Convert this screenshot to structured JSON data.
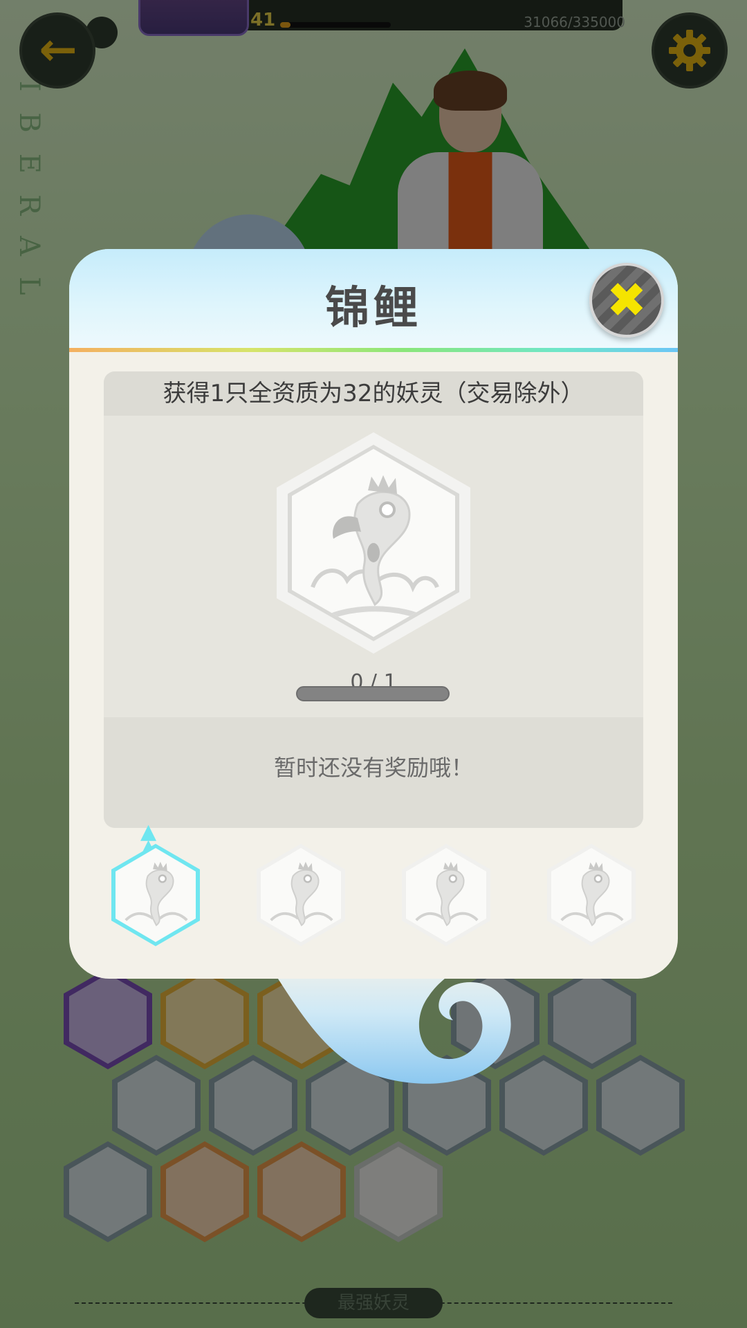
{
  "hud": {
    "level": "41",
    "exp_text": "31066/335000",
    "exp_fraction": 0.093
  },
  "background": {
    "side_text": "LIBERAL",
    "bottom_tab": "最强妖灵"
  },
  "modal": {
    "title": "锦鲤",
    "task_text": "获得1只全资质为32的妖灵（交易除外）",
    "progress_text": "0 / 1",
    "progress_fraction": 0,
    "reward_text": "暂时还没有奖励哦！",
    "tiers": [
      {
        "active": true
      },
      {
        "active": false
      },
      {
        "active": false
      },
      {
        "active": false
      }
    ]
  },
  "colors": {
    "accent_cyan": "#6fe6f0",
    "close_x": "#f5e400",
    "hud_yellow": "#e8b814"
  },
  "icons": {
    "back": "back-arrow-icon",
    "settings": "gear-icon",
    "close": "close-icon",
    "koi": "koi-fish-icon",
    "selected_tier": "double-chevron-up-icon"
  }
}
